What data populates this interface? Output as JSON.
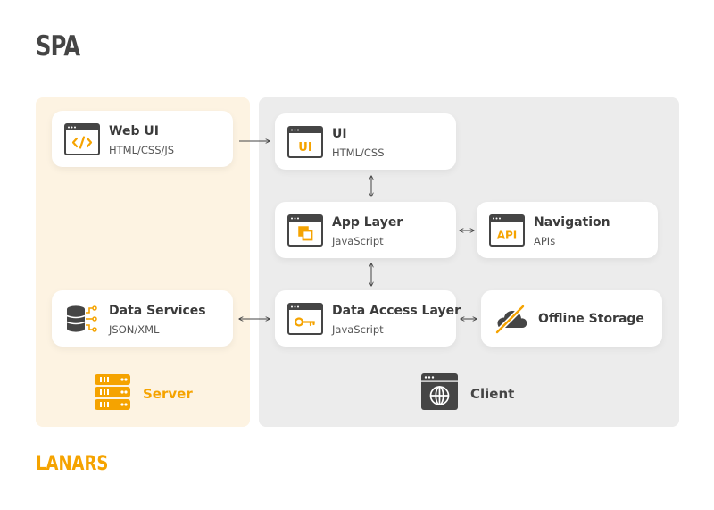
{
  "title": "SPA",
  "brand": "LANARS",
  "colors": {
    "accent": "#f5a300",
    "dark": "#454545",
    "server_bg": "#fdf3e2",
    "client_bg": "#ececec"
  },
  "legend": {
    "server": {
      "label": "Server",
      "icon": "server-rack-icon"
    },
    "client": {
      "label": "Client",
      "icon": "browser-globe-icon"
    }
  },
  "cards": {
    "web_ui": {
      "name": "Web UI",
      "sub": "HTML/CSS/JS",
      "icon": "code-window-icon"
    },
    "ui": {
      "name": "UI",
      "sub": "HTML/CSS",
      "icon": "ui-window-icon"
    },
    "app_layer": {
      "name": "App Layer",
      "sub": "JavaScript",
      "icon": "layers-window-icon"
    },
    "navigation": {
      "name": "Navigation",
      "sub": "APIs",
      "icon": "api-window-icon"
    },
    "data_services": {
      "name": "Data Services",
      "sub": "JSON/XML",
      "icon": "database-icon"
    },
    "data_access": {
      "name": "Data Access Layer",
      "sub": "JavaScript",
      "icon": "key-window-icon"
    },
    "offline": {
      "name": "Offline Storage",
      "icon": "cloud-off-icon"
    }
  }
}
